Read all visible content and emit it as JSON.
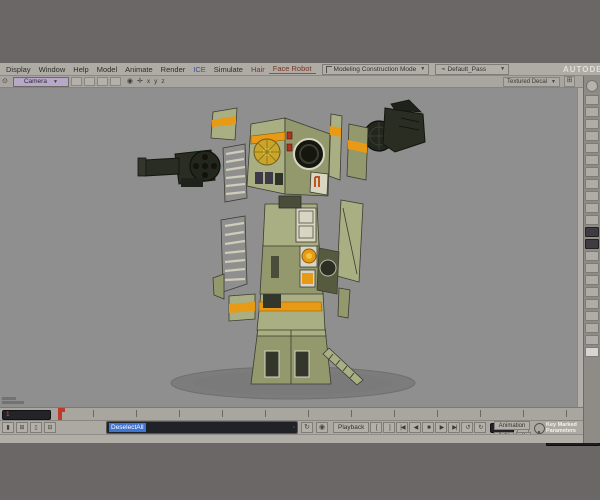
{
  "colors": {
    "letterbox": "#6B6767",
    "ui": "#AFACA6",
    "vp": "#8F8F8F",
    "cam": "#B7A7C8",
    "blue": "#3F74D1",
    "script": "#212227",
    "red": "#C0392B",
    "olive": "#93996D",
    "olive_light": "#A9AE83",
    "olive_dark": "#565B40",
    "orange": "#E89A15",
    "cream": "#D9D5C3",
    "gun": "#2A2D22",
    "shadow": "#7C7C7C",
    "teal": "#3FA38C"
  },
  "brand": "AUTODESK",
  "menu_bar": {
    "items": [
      "Display",
      "Window",
      "Help",
      "Model",
      "Animate",
      "Render",
      "ICE",
      "Simulate",
      "Hair",
      "Face Robot"
    ],
    "construction_mode": "Modeling Construction Mode",
    "render_pass": "Default_Pass"
  },
  "viewport": {
    "camera": "Camera",
    "axis": [
      "x",
      "y",
      "z"
    ],
    "display_mode": "Textured Decal",
    "scene": "exploded olive-green mech robot with orange stripes over gray backdrop"
  },
  "timeline": {
    "current_frame": "1"
  },
  "command_line": {
    "last_command": "DeselectAll"
  },
  "playback": {
    "label": "Playback",
    "transport": [
      "[",
      "]",
      "|◀",
      "◀",
      "■",
      "▶",
      "▶|",
      "↺",
      "↻"
    ],
    "animation": "Animation",
    "auto": "Auto",
    "prev_key": "◂",
    "next_key": "▸",
    "key_marked": "Key Marked Parameters"
  },
  "layout_switch": {
    "buttons": [
      "▮",
      "⊞",
      "▯",
      "⊟"
    ]
  },
  "right_panel": {
    "button_count": 22,
    "dark_buttons": [
      11,
      12
    ],
    "light_buttons": [
      21
    ]
  }
}
